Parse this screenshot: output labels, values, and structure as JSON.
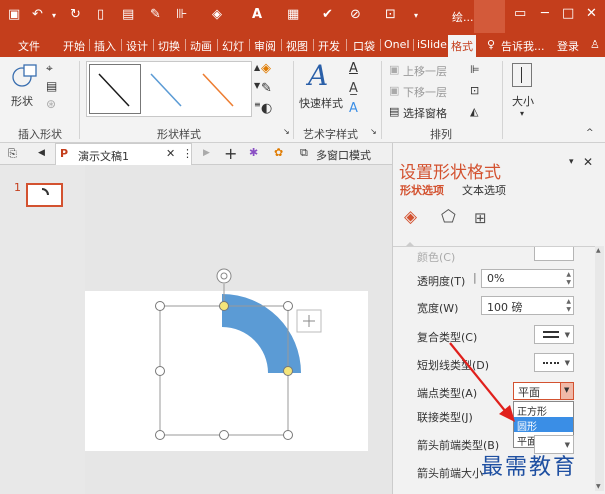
{
  "titlebar": {
    "title": "绘...",
    "quick_access": [
      "save-icon",
      "undo-icon",
      "redo-icon",
      "new-icon",
      "slides-icon",
      "pen-icon",
      "format-painter-icon",
      "fill-icon",
      "font-color-icon",
      "paste-icon",
      "brush-icon",
      "clear-icon",
      "customize-icon"
    ],
    "window": {
      "restore": "▭",
      "minimize": "─",
      "maximize": "□",
      "close": "✕"
    }
  },
  "tabs": [
    "文件",
    "开始",
    "插入",
    "设计",
    "切换",
    "动画",
    "幻灯",
    "审阅",
    "视图",
    "开发",
    "口袋",
    "OneI",
    "iSlide",
    "格式"
  ],
  "active_tab": "格式",
  "tell_me": "告诉我...",
  "login": "登录",
  "ribbon": {
    "insert_shapes": {
      "label": "插入形状",
      "shape_btn": "形状"
    },
    "shape_styles": {
      "label": "形状样式",
      "colors": [
        "#1a1a1a",
        "#5b9bd5",
        "#ed7d31"
      ]
    },
    "art_styles": {
      "label": "艺术字样式",
      "quick_styles": "快速样式",
      "a_glyph": "A"
    },
    "arrange": {
      "label": "排列",
      "bring_forward": "上移一层",
      "send_backward": "下移一层",
      "selection_pane": "选择窗格"
    },
    "size": {
      "label": "大小"
    }
  },
  "docbar": {
    "doc_name": "演示文稿1",
    "multi_window": "多窗口模式"
  },
  "thumbs": {
    "slide_number": "1"
  },
  "pane": {
    "title": "设置形状格式",
    "tab_shape": "形状选项",
    "tab_text": "文本选项",
    "transparency_label": "透明度(T)",
    "transparency_value": "0%",
    "width_label": "宽度(W)",
    "width_value": "100 磅",
    "compound_label": "复合类型(C)",
    "dash_label": "短划线类型(D)",
    "cap_label": "端点类型(A)",
    "cap_value": "平面",
    "join_label": "联接类型(J)",
    "arrow_begin_type_label": "箭头前端类型(B)",
    "arrow_begin_size_label": "箭头前端大小",
    "cap_options": [
      "正方形",
      "圆形",
      "平面"
    ],
    "cap_highlighted": "圆形"
  },
  "watermark": "最需教育",
  "colors": {
    "accent": "#c43e1c",
    "arc": "#5b9bd5",
    "highlight": "#3a8ee6",
    "arrow": "#e0201c"
  }
}
